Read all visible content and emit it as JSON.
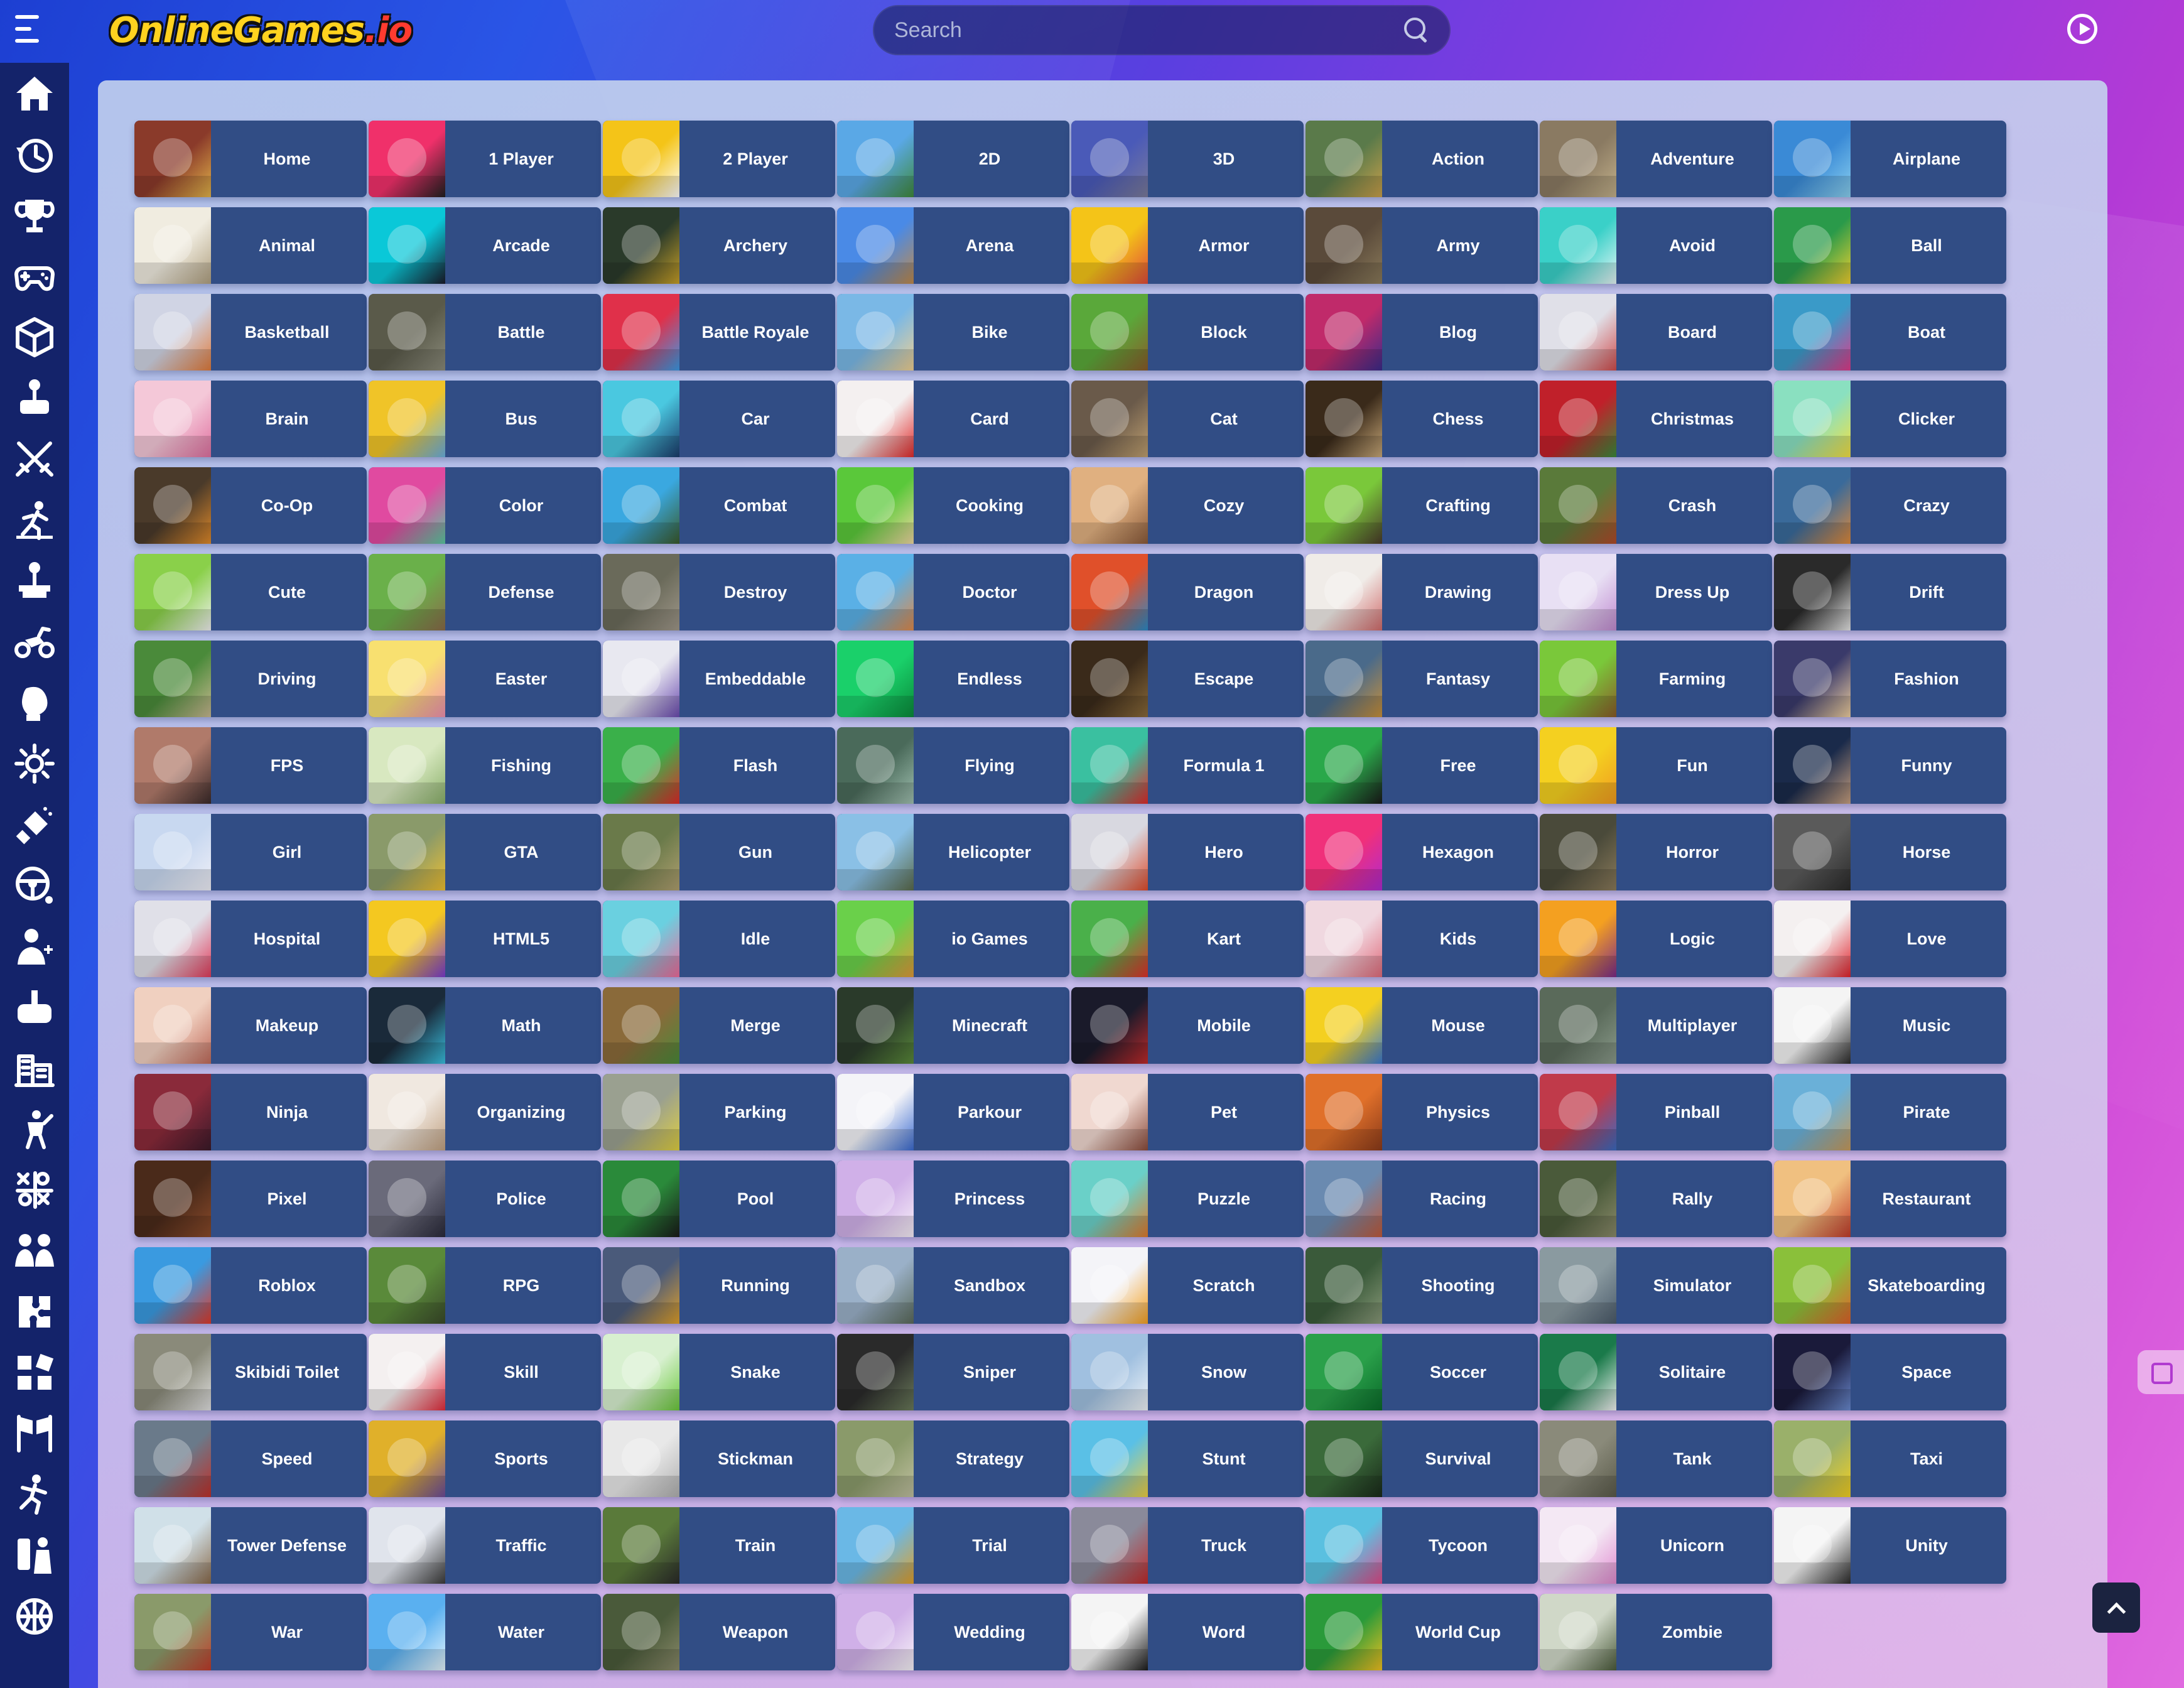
{
  "header": {
    "logo_main": "OnlineGames",
    "logo_suffix": ".io",
    "search_placeholder": "Search"
  },
  "sidebar": {
    "items": [
      {
        "icon": "home-icon"
      },
      {
        "icon": "history-icon"
      },
      {
        "icon": "trophy-icon"
      },
      {
        "icon": "gamepad-icon"
      },
      {
        "icon": "dice-icon"
      },
      {
        "icon": "joystick-icon"
      },
      {
        "icon": "swords-icon"
      },
      {
        "icon": "runner-icon"
      },
      {
        "icon": "arcade-stick-icon"
      },
      {
        "icon": "motorbike-icon"
      },
      {
        "icon": "boxing-glove-icon"
      },
      {
        "icon": "gear-icon"
      },
      {
        "icon": "spray-icon"
      },
      {
        "icon": "steering-wheel-icon"
      },
      {
        "icon": "doctor-icon"
      },
      {
        "icon": "controller-plus-icon"
      },
      {
        "icon": "city-icon"
      },
      {
        "icon": "fighter-icon"
      },
      {
        "icon": "tic-tac-toe-icon"
      },
      {
        "icon": "two-players-icon"
      },
      {
        "icon": "puzzle-icon"
      },
      {
        "icon": "blocks-icon"
      },
      {
        "icon": "race-flags-icon"
      },
      {
        "icon": "stickman-icon"
      },
      {
        "icon": "multiplayer-icon"
      },
      {
        "icon": "ball-icon"
      }
    ]
  },
  "categories": [
    {
      "label": "Home",
      "c1": "#8a3a2a",
      "c2": "#e2b34a"
    },
    {
      "label": "1 Player",
      "c1": "#f0306a",
      "c2": "#202020"
    },
    {
      "label": "2 Player",
      "c1": "#f4c418",
      "c2": "#ffffff"
    },
    {
      "label": "2D",
      "c1": "#5aa8e6",
      "c2": "#3f8a3a"
    },
    {
      "label": "3D",
      "c1": "#4a5ab8",
      "c2": "#7b7b9a"
    },
    {
      "label": "Action",
      "c1": "#5a7a4a",
      "c2": "#c9a04a"
    },
    {
      "label": "Adventure",
      "c1": "#8a7a62",
      "c2": "#c2b08a"
    },
    {
      "label": "Airplane",
      "c1": "#3a8ad6",
      "c2": "#8ad0f0"
    },
    {
      "label": "Animal",
      "c1": "#f0ece0",
      "c2": "#b0a080"
    },
    {
      "label": "Arcade",
      "c1": "#0ac8d8",
      "c2": "#1a1a2a"
    },
    {
      "label": "Archery",
      "c1": "#2a3a2a",
      "c2": "#c8a028"
    },
    {
      "label": "Arena",
      "c1": "#4a8ae6",
      "c2": "#c08a4a"
    },
    {
      "label": "Armor",
      "c1": "#f4c418",
      "c2": "#e04a3a"
    },
    {
      "label": "Army",
      "c1": "#5a4a3a",
      "c2": "#8a7a5a"
    },
    {
      "label": "Avoid",
      "c1": "#3ad0c8",
      "c2": "#e6f6f6"
    },
    {
      "label": "Ball",
      "c1": "#2a9a4a",
      "c2": "#f0d030"
    },
    {
      "label": "Basketball",
      "c1": "#d0d4e4",
      "c2": "#e07a3a"
    },
    {
      "label": "Battle",
      "c1": "#5a5a4a",
      "c2": "#8a8a7a"
    },
    {
      "label": "Battle Royale",
      "c1": "#e0304a",
      "c2": "#3a9ae6"
    },
    {
      "label": "Bike",
      "c1": "#7ab8e6",
      "c2": "#f0d090"
    },
    {
      "label": "Block",
      "c1": "#5aa83a",
      "c2": "#8a5a2a"
    },
    {
      "label": "Blog",
      "c1": "#c02a6a",
      "c2": "#3a2a8a"
    },
    {
      "label": "Board",
      "c1": "#e0e0e8",
      "c2": "#d04a4a"
    },
    {
      "label": "Boat",
      "c1": "#3a9ac8",
      "c2": "#e03a8a"
    },
    {
      "label": "Brain",
      "c1": "#f4c8d8",
      "c2": "#e070a0"
    },
    {
      "label": "Bus",
      "c1": "#f0c428",
      "c2": "#6ab0e0"
    },
    {
      "label": "Car",
      "c1": "#4ac8e0",
      "c2": "#1a3a6a"
    },
    {
      "label": "Card",
      "c1": "#f4f0f0",
      "c2": "#e02a2a"
    },
    {
      "label": "Cat",
      "c1": "#6a5a4a",
      "c2": "#c0a070"
    },
    {
      "label": "Chess",
      "c1": "#3a2a1a",
      "c2": "#c8a878"
    },
    {
      "label": "Christmas",
      "c1": "#c0202a",
      "c2": "#3a8a3a"
    },
    {
      "label": "Clicker",
      "c1": "#8ae0c0",
      "c2": "#f4e040"
    },
    {
      "label": "Co-Op",
      "c1": "#4a3a2a",
      "c2": "#e08a2a"
    },
    {
      "label": "Color",
      "c1": "#e04aa0",
      "c2": "#5ac8a0"
    },
    {
      "label": "Combat",
      "c1": "#3aa8e0",
      "c2": "#3a5a2a"
    },
    {
      "label": "Cooking",
      "c1": "#5ac83a",
      "c2": "#f0d8a0"
    },
    {
      "label": "Cozy",
      "c1": "#e0b080",
      "c2": "#8a5a3a"
    },
    {
      "label": "Crafting",
      "c1": "#7ac83a",
      "c2": "#4a3a2a"
    },
    {
      "label": "Crash",
      "c1": "#5a7a3a",
      "c2": "#b04a2a"
    },
    {
      "label": "Crazy",
      "c1": "#3a6a9a",
      "c2": "#e08a3a"
    },
    {
      "label": "Cute",
      "c1": "#8ad04a",
      "c2": "#f0f0f0"
    },
    {
      "label": "Defense",
      "c1": "#6ab04a",
      "c2": "#8a6a4a"
    },
    {
      "label": "Destroy",
      "c1": "#6a6a5a",
      "c2": "#a0988a"
    },
    {
      "label": "Doctor",
      "c1": "#5ab0e6",
      "c2": "#e08a4a"
    },
    {
      "label": "Dragon",
      "c1": "#e0502a",
      "c2": "#2a8ac8"
    },
    {
      "label": "Drawing",
      "c1": "#f0ece8",
      "c2": "#d06a6a"
    },
    {
      "label": "Dress Up",
      "c1": "#e8e0f4",
      "c2": "#c08ad0"
    },
    {
      "label": "Drift",
      "c1": "#2a2a2a",
      "c2": "#e6e6e6"
    },
    {
      "label": "Driving",
      "c1": "#4a8a3a",
      "c2": "#c8b890"
    },
    {
      "label": "Easter",
      "c1": "#f8e070",
      "c2": "#f090b0"
    },
    {
      "label": "Embeddable",
      "c1": "#e8e8f0",
      "c2": "#6a4ab0"
    },
    {
      "label": "Endless",
      "c1": "#1ad06a",
      "c2": "#0a8a3a"
    },
    {
      "label": "Escape",
      "c1": "#3a2a1a",
      "c2": "#8a6a3a"
    },
    {
      "label": "Fantasy",
      "c1": "#4a6a8a",
      "c2": "#c8903a"
    },
    {
      "label": "Farming",
      "c1": "#7ac83a",
      "c2": "#8a5a2a"
    },
    {
      "label": "Fashion",
      "c1": "#3a3a6a",
      "c2": "#f0d0a0"
    },
    {
      "label": "FPS",
      "c1": "#b07a6a",
      "c2": "#3a2a2a"
    },
    {
      "label": "Fishing",
      "c1": "#d8e8c0",
      "c2": "#8ab06a"
    },
    {
      "label": "Flash",
      "c1": "#3ab04a",
      "c2": "#e02a2a"
    },
    {
      "label": "Flying",
      "c1": "#4a6a5a",
      "c2": "#a0c0b0"
    },
    {
      "label": "Formula 1",
      "c1": "#3ac0a0",
      "c2": "#e02a2a"
    },
    {
      "label": "Free",
      "c1": "#2aa84a",
      "c2": "#1a1a1a"
    },
    {
      "label": "Fun",
      "c1": "#f4d020",
      "c2": "#f09a20"
    },
    {
      "label": "Funny",
      "c1": "#1a2a4a",
      "c2": "#c8a080"
    },
    {
      "label": "Girl",
      "c1": "#c8d8f0",
      "c2": "#f0f0f8"
    },
    {
      "label": "GTA",
      "c1": "#8a9a6a",
      "c2": "#f0c030"
    },
    {
      "label": "Gun",
      "c1": "#6a7a4a",
      "c2": "#b0a070"
    },
    {
      "label": "Helicopter",
      "c1": "#8ac0e6",
      "c2": "#5a6a4a"
    },
    {
      "label": "Hero",
      "c1": "#d8d8e0",
      "c2": "#e04a2a"
    },
    {
      "label": "Hexagon",
      "c1": "#f0307a",
      "c2": "#b02ad0"
    },
    {
      "label": "Horror",
      "c1": "#4a4a3a",
      "c2": "#8a7a5a"
    },
    {
      "label": "Horse",
      "c1": "#5a5a5a",
      "c2": "#2a2a2a"
    },
    {
      "label": "Hospital",
      "c1": "#e0e0e8",
      "c2": "#e03a5a"
    },
    {
      "label": "HTML5",
      "c1": "#f4c820",
      "c2": "#7a3ad0"
    },
    {
      "label": "Idle",
      "c1": "#6ad0e0",
      "c2": "#f06a9a"
    },
    {
      "label": "io Games",
      "c1": "#6ad04a",
      "c2": "#e09a3a"
    },
    {
      "label": "Kart",
      "c1": "#4ab04a",
      "c2": "#e0302a"
    },
    {
      "label": "Kids",
      "c1": "#f0d8e0",
      "c2": "#e06a7a"
    },
    {
      "label": "Logic",
      "c1": "#f4a020",
      "c2": "#7a2a8a"
    },
    {
      "label": "Love",
      "c1": "#f4f0f0",
      "c2": "#e0202a"
    },
    {
      "label": "Makeup",
      "c1": "#f0d0c0",
      "c2": "#c06a5a"
    },
    {
      "label": "Math",
      "c1": "#1a2a3a",
      "c2": "#3ac0e0"
    },
    {
      "label": "Merge",
      "c1": "#8a6a3a",
      "c2": "#4a8a3a"
    },
    {
      "label": "Minecraft",
      "c1": "#2a3a2a",
      "c2": "#5a8a3a"
    },
    {
      "label": "Mobile",
      "c1": "#1a1a2a",
      "c2": "#c02a2a"
    },
    {
      "label": "Mouse",
      "c1": "#f4d020",
      "c2": "#3a7ad0"
    },
    {
      "label": "Multiplayer",
      "c1": "#5a6a5a",
      "c2": "#8a9a8a"
    },
    {
      "label": "Music",
      "c1": "#f4f4f4",
      "c2": "#2a2a2a"
    },
    {
      "label": "Ninja",
      "c1": "#8a2a3a",
      "c2": "#3a1a2a"
    },
    {
      "label": "Organizing",
      "c1": "#f0e8e0",
      "c2": "#c0a080"
    },
    {
      "label": "Parking",
      "c1": "#9aa090",
      "c2": "#e0d040"
    },
    {
      "label": "Parkour",
      "c1": "#f4f4f8",
      "c2": "#3a6ad0"
    },
    {
      "label": "Pet",
      "c1": "#f0d8d0",
      "c2": "#8a4a3a"
    },
    {
      "label": "Physics",
      "c1": "#e0702a",
      "c2": "#8a3a1a"
    },
    {
      "label": "Pinball",
      "c1": "#c03a4a",
      "c2": "#3a6ac0"
    },
    {
      "label": "Pirate",
      "c1": "#6ab0d8",
      "c2": "#c89a5a"
    },
    {
      "label": "Pixel",
      "c1": "#4a2a1a",
      "c2": "#8a4a2a"
    },
    {
      "label": "Police",
      "c1": "#6a6a7a",
      "c2": "#2a2a3a"
    },
    {
      "label": "Pool",
      "c1": "#2a8a3a",
      "c2": "#1a1a1a"
    },
    {
      "label": "Princess",
      "c1": "#d0b0e8",
      "c2": "#f8f0f8"
    },
    {
      "label": "Puzzle",
      "c1": "#6ad0c8",
      "c2": "#e07a2a"
    },
    {
      "label": "Racing",
      "c1": "#6a8ab0",
      "c2": "#c05a3a"
    },
    {
      "label": "Rally",
      "c1": "#4a5a3a",
      "c2": "#8a8a6a"
    },
    {
      "label": "Restaurant",
      "c1": "#f0c080",
      "c2": "#c03a2a"
    },
    {
      "label": "Roblox",
      "c1": "#3a9ae0",
      "c2": "#e03a2a"
    },
    {
      "label": "RPG",
      "c1": "#5a8a3a",
      "c2": "#3a4a2a"
    },
    {
      "label": "Running",
      "c1": "#4a5a7a",
      "c2": "#e0a02a"
    },
    {
      "label": "Sandbox",
      "c1": "#9ab0c8",
      "c2": "#5a6a5a"
    },
    {
      "label": "Scratch",
      "c1": "#f4f4f8",
      "c2": "#f4a020"
    },
    {
      "label": "Shooting",
      "c1": "#3a5a3a",
      "c2": "#8a9a7a"
    },
    {
      "label": "Simulator",
      "c1": "#8a9aa0",
      "c2": "#4a5a6a"
    },
    {
      "label": "Skateboarding",
      "c1": "#8ac03a",
      "c2": "#e0602a"
    },
    {
      "label": "Skibidi Toilet",
      "c1": "#8a8a7a",
      "c2": "#e0e0e0"
    },
    {
      "label": "Skill",
      "c1": "#f4f0f0",
      "c2": "#e02a3a"
    },
    {
      "label": "Snake",
      "c1": "#d8f0d0",
      "c2": "#6ac83a"
    },
    {
      "label": "Sniper",
      "c1": "#2a2a2a",
      "c2": "#6a7a5a"
    },
    {
      "label": "Snow",
      "c1": "#a0c0e0",
      "c2": "#f0f4f8"
    },
    {
      "label": "Soccer",
      "c1": "#2aa04a",
      "c2": "#0a6a2a"
    },
    {
      "label": "Solitaire",
      "c1": "#1a7a4a",
      "c2": "#f4f4f4"
    },
    {
      "label": "Space",
      "c1": "#1a1a3a",
      "c2": "#6a8ad0"
    },
    {
      "label": "Speed",
      "c1": "#6a7a8a",
      "c2": "#c0302a"
    },
    {
      "label": "Sports",
      "c1": "#e0b02a",
      "c2": "#6a4a9a"
    },
    {
      "label": "Stickman",
      "c1": "#e8e8e8",
      "c2": "#b0b0b0"
    },
    {
      "label": "Strategy",
      "c1": "#8a9a6a",
      "c2": "#c0c0a0"
    },
    {
      "label": "Stunt",
      "c1": "#5ac0e6",
      "c2": "#f0d040"
    },
    {
      "label": "Survival",
      "c1": "#3a6a3a",
      "c2": "#1a2a1a"
    },
    {
      "label": "Tank",
      "c1": "#8a8a7a",
      "c2": "#5a5a4a"
    },
    {
      "label": "Taxi",
      "c1": "#9ab06a",
      "c2": "#f4d020"
    },
    {
      "label": "Tower Defense",
      "c1": "#d0e0e8",
      "c2": "#8a6a4a"
    },
    {
      "label": "Traffic",
      "c1": "#e0e4ec",
      "c2": "#3a3a3a"
    },
    {
      "label": "Train",
      "c1": "#5a7a3a",
      "c2": "#2a2a2a"
    },
    {
      "label": "Trial",
      "c1": "#6ab8e6",
      "c2": "#e0a02a"
    },
    {
      "label": "Truck",
      "c1": "#8a8a9a",
      "c2": "#c02a2a"
    },
    {
      "label": "Tycoon",
      "c1": "#5ac0e0",
      "c2": "#e04a8a"
    },
    {
      "label": "Unicorn",
      "c1": "#f4e8f4",
      "c2": "#e08ad0"
    },
    {
      "label": "Unity",
      "c1": "#f4f4f4",
      "c2": "#2a2a2a"
    },
    {
      "label": "War",
      "c1": "#8a9a6a",
      "c2": "#c03a2a"
    },
    {
      "label": "Water",
      "c1": "#5ab0f0",
      "c2": "#e6f4fc"
    },
    {
      "label": "Weapon",
      "c1": "#4a5a3a",
      "c2": "#8a8a6a"
    },
    {
      "label": "Wedding",
      "c1": "#d0b0e8",
      "c2": "#f8f4f8"
    },
    {
      "label": "Word",
      "c1": "#f4f4f4",
      "c2": "#1a1a1a"
    },
    {
      "label": "World Cup",
      "c1": "#2a9a3a",
      "c2": "#f0c020"
    },
    {
      "label": "Zombie",
      "c1": "#d0d8c8",
      "c2": "#4a5a3a"
    }
  ]
}
